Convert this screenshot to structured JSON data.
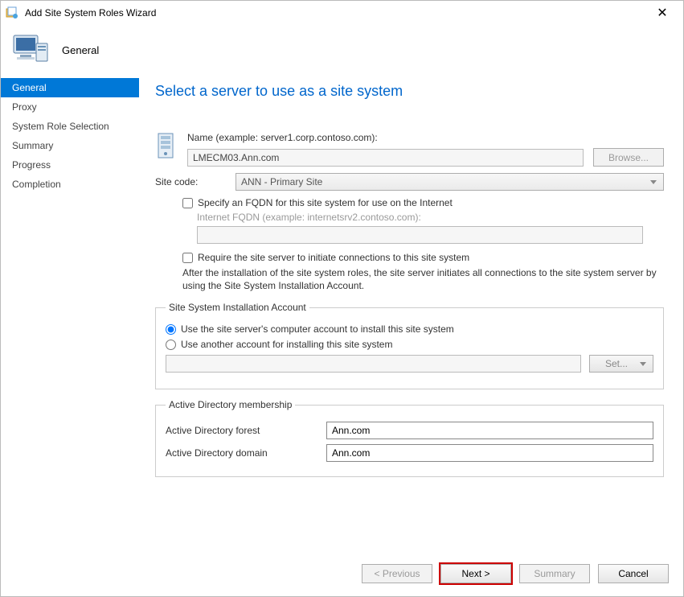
{
  "window": {
    "title": "Add Site System Roles Wizard"
  },
  "header": {
    "title": "General"
  },
  "nav": {
    "items": [
      {
        "label": "General",
        "active": true
      },
      {
        "label": "Proxy"
      },
      {
        "label": "System Role Selection"
      },
      {
        "label": "Summary"
      },
      {
        "label": "Progress"
      },
      {
        "label": "Completion"
      }
    ]
  },
  "page": {
    "title": "Select a server to use as a site system",
    "name_label": "Name (example: server1.corp.contoso.com):",
    "name_value": "LMECM03.Ann.com",
    "browse_label": "Browse...",
    "site_code_label": "Site code:",
    "site_code_value": "ANN - Primary Site",
    "fqdn_checkbox": "Specify an FQDN for this site system for use on the Internet",
    "internet_fqdn_label": "Internet FQDN (example: internetsrv2.contoso.com):",
    "require_checkbox": "Require the site server to initiate connections to this site system",
    "require_desc": "After the  installation of the site system roles, the site server initiates all connections to the site system server by using the Site System Installation Account.",
    "account_legend": "Site System Installation Account",
    "radio1": "Use the site server's computer account to install this site system",
    "radio2": "Use another account for installing this site system",
    "set_label": "Set...",
    "ad_legend": "Active Directory membership",
    "ad_forest_label": "Active Directory forest",
    "ad_forest_value": "Ann.com",
    "ad_domain_label": "Active Directory domain",
    "ad_domain_value": "Ann.com"
  },
  "footer": {
    "previous": "< Previous",
    "next": "Next >",
    "summary": "Summary",
    "cancel": "Cancel"
  }
}
